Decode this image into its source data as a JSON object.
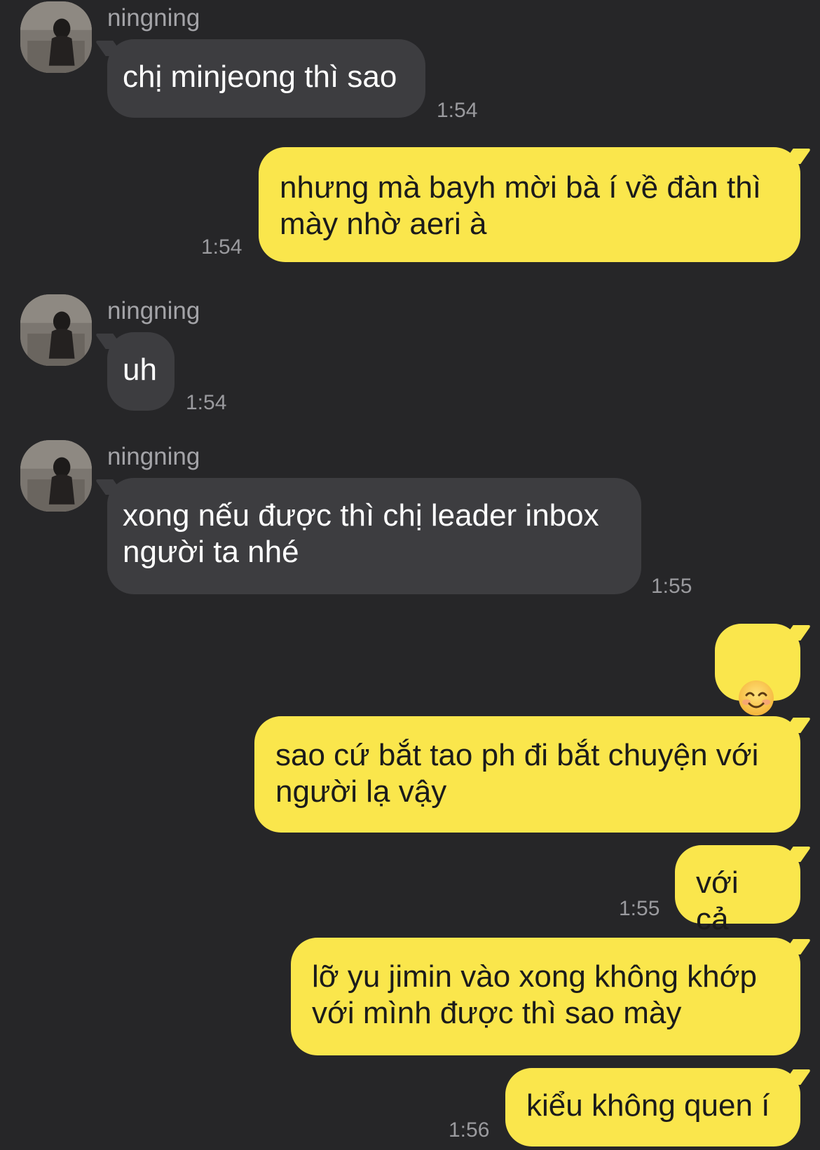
{
  "chat": {
    "messages": [
      {
        "sender": "ningning",
        "text": "chị minjeong thì sao",
        "time": "1:54"
      },
      {
        "text": "nhưng mà bayh mời bà í về đàn thì\nmày nhờ aeri à",
        "time": "1:54"
      },
      {
        "sender": "ningning",
        "text": "uh",
        "time": "1:54"
      },
      {
        "sender": "ningning",
        "text": "xong nếu được thì chị leader inbox\nngười ta nhé",
        "time": "1:55"
      },
      {
        "emoji": "smiling-face-emoji"
      },
      {
        "text": "sao cứ bắt tao ph đi bắt chuyện với\nngười lạ vậy"
      },
      {
        "text": "với cả",
        "time": "1:55"
      },
      {
        "text": "lỡ yu jimin vào xong không khớp\nvới mình được thì sao mày"
      },
      {
        "text": "kiểu không quen í",
        "time": "1:56"
      }
    ]
  },
  "colors": {
    "background": "#262628",
    "incoming_bubble": "#3d3d40",
    "outgoing_bubble": "#fae64c",
    "timestamp": "#9a9a9e",
    "sender_name": "#a4a4a8"
  }
}
